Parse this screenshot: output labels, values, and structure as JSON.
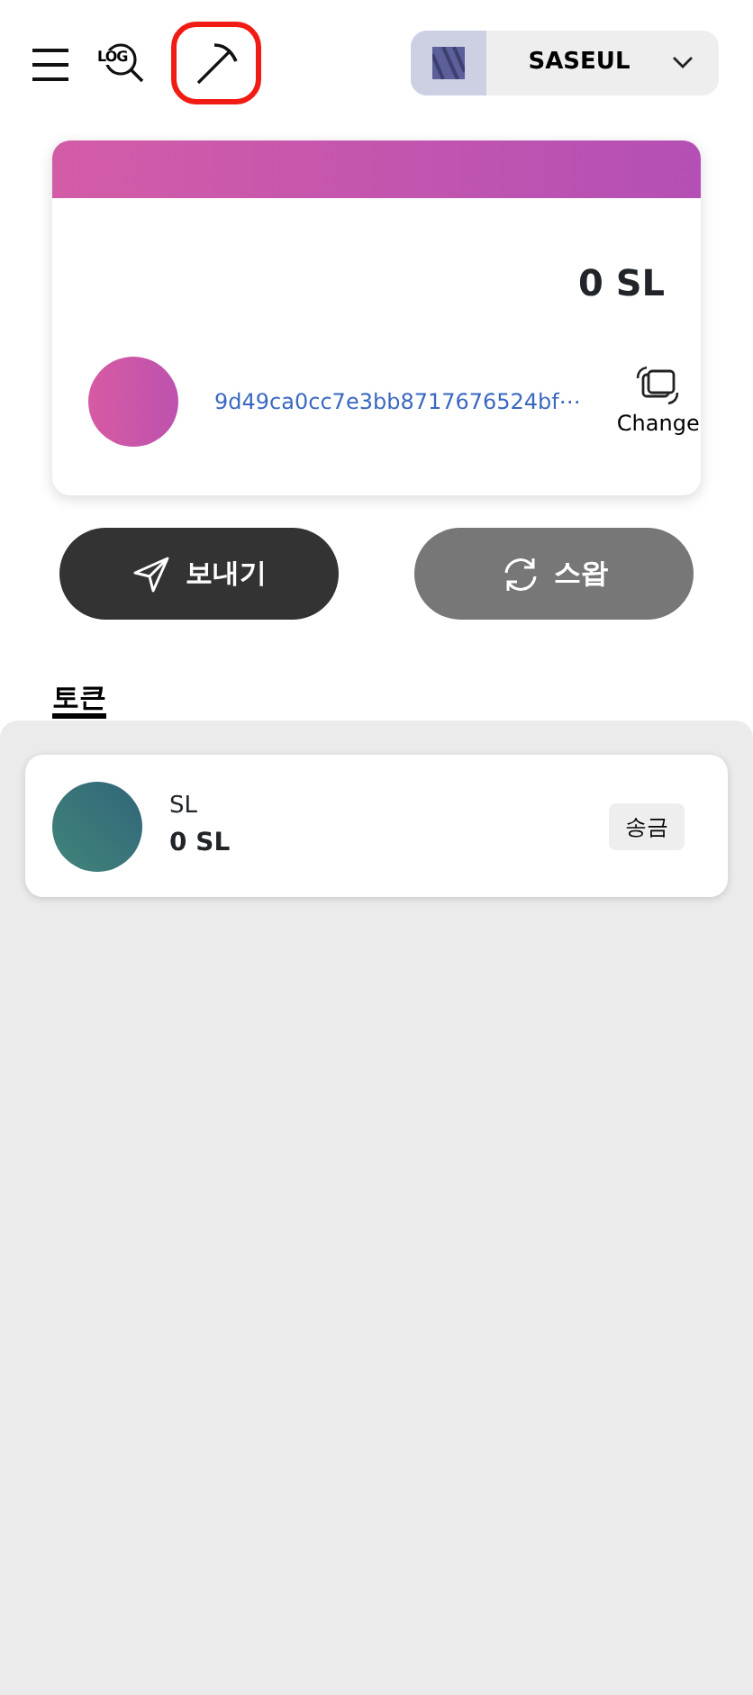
{
  "header": {
    "log_label": "LOG",
    "miner_highlighted": true,
    "network": "SASEUL"
  },
  "wallet": {
    "balance": "0 SL",
    "address": "9d49ca0cc7e3bb8717676524bf⋯",
    "change_label": "Change"
  },
  "actions": [
    {
      "kind": "send",
      "label": "보내기"
    },
    {
      "kind": "swap",
      "label": "스왑"
    }
  ],
  "tabs": [
    {
      "label": "토큰",
      "selected": true
    }
  ],
  "tokens": [
    {
      "name": "SL",
      "amount": "0 SL",
      "button": "송금"
    }
  ]
}
